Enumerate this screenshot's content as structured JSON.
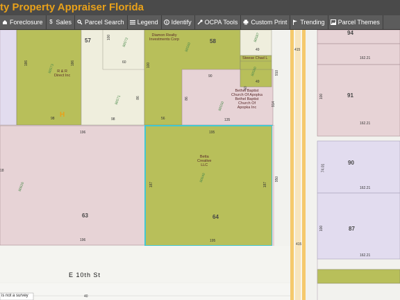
{
  "header": {
    "title": "ty Property Appraiser Florida"
  },
  "toolbar": {
    "items": [
      {
        "label": "Foreclosure",
        "icon": "house-icon"
      },
      {
        "label": "Sales",
        "icon": "dollar-icon"
      },
      {
        "label": "Parcel Search",
        "icon": "search-icon"
      },
      {
        "label": "Legend",
        "icon": "list-icon"
      },
      {
        "label": "Identify",
        "icon": "info-icon"
      },
      {
        "label": "OCPA Tools",
        "icon": "wrench-icon"
      },
      {
        "label": "Custom Print",
        "icon": "printer-icon"
      },
      {
        "label": "Trending",
        "icon": "flag-icon"
      },
      {
        "label": "Parcel Themes",
        "icon": "image-icon"
      }
    ]
  },
  "map": {
    "street": "E 10th St",
    "disclaimer": "is not a survey",
    "parcels": {
      "p57": "57",
      "p58": "58",
      "p94": "94",
      "p91": "91",
      "p90": "90",
      "p87": "87",
      "p63": "63",
      "p64": "64"
    },
    "owners": {
      "rr_direct": "R & R\nDirect Inc",
      "diamon": "Diamon Realty\nInvestments Corp",
      "steese": "Steese Chad L",
      "bethel": "Bethel Baptist\nChurch Of Apopka\nBethel Baptist\nChurch Of\nApopka Inc",
      "betta": "Betta\nCreative\nLLC"
    },
    "dims": {
      "d186a": "186",
      "d186b": "186",
      "d100a": "100",
      "d60": "60",
      "d100b": "100",
      "d98a": "98",
      "d98b": "98",
      "d86": "86",
      "d56": "56",
      "d50": "50",
      "d49a": "49",
      "d49b": "49",
      "d90": "90",
      "d86b": "86",
      "d135": "135",
      "d910": "910",
      "d914": "914",
      "d196a": "196",
      "d195a": "195",
      "d187a": "187",
      "d187b": "187",
      "d195b": "195",
      "d196b": "196",
      "d950": "950",
      "d40": "40",
      "d16221a": "162.21",
      "d16221b": "162.21",
      "d16221c": "162.21",
      "d16221d": "162.21",
      "d100c": "100",
      "d100d": "100",
      "d7401": "74.01",
      "d415a": "415",
      "d415b": "415",
      "d18a": "18"
    },
    "codes": {
      "c1": "80572",
      "c2": "80560",
      "c3": "80573",
      "c4": "80571",
      "c5": "80587",
      "c6": "80580",
      "c7": "80550",
      "c8": "80640",
      "c9": "80626"
    },
    "colors": {
      "pink": "#e7d3d6",
      "green": "#b8bf5a",
      "cream": "#efeedd",
      "lavender": "#e2dcef",
      "road": "#f5c96c",
      "selected": "#43c7d2"
    }
  }
}
